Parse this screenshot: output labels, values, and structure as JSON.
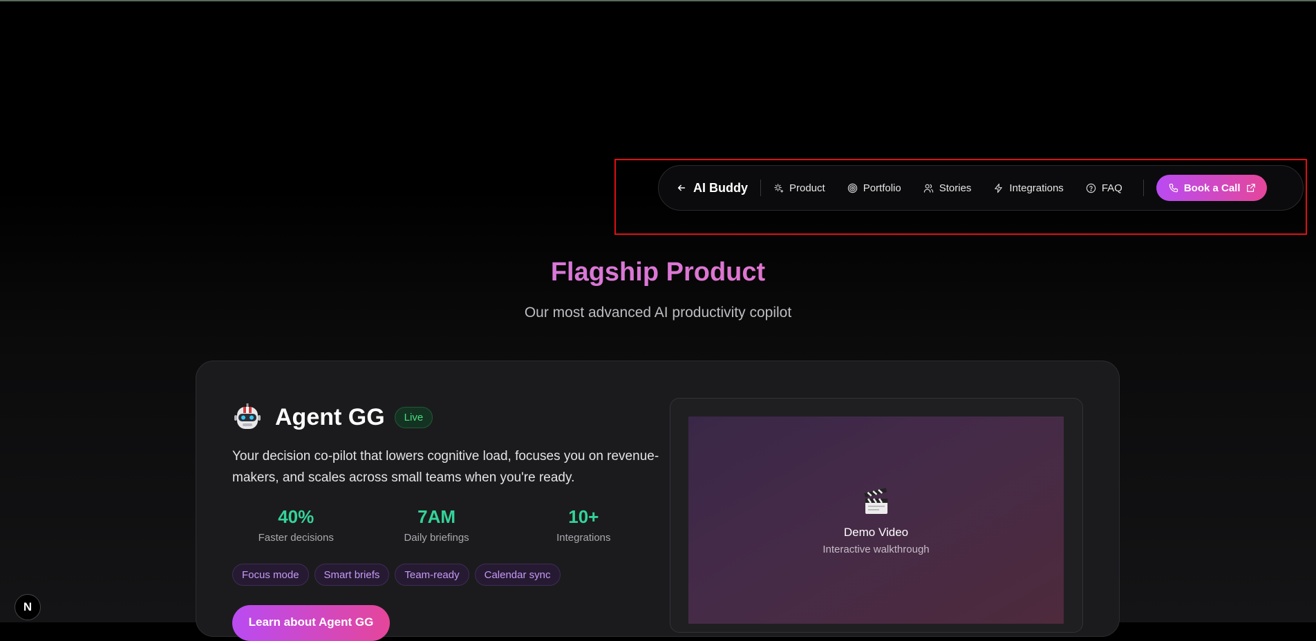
{
  "nav": {
    "brand": "AI Buddy",
    "items": [
      {
        "label": "Product",
        "icon": "sparkles-icon"
      },
      {
        "label": "Portfolio",
        "icon": "target-icon"
      },
      {
        "label": "Stories",
        "icon": "users-icon"
      },
      {
        "label": "Integrations",
        "icon": "zap-icon"
      },
      {
        "label": "FAQ",
        "icon": "help-circle-icon"
      }
    ],
    "cta": "Book a Call"
  },
  "hero": {
    "title": "Flagship Product",
    "subtitle": "Our most advanced AI productivity copilot"
  },
  "product": {
    "name": "Agent GG",
    "status": "Live",
    "description": "Your decision co-pilot that lowers cognitive load, focuses you on revenue-makers, and scales across small teams when you're ready.",
    "stats": [
      {
        "value": "40%",
        "label": "Faster decisions"
      },
      {
        "value": "7AM",
        "label": "Daily briefings"
      },
      {
        "value": "10+",
        "label": "Integrations"
      }
    ],
    "tags": [
      "Focus mode",
      "Smart briefs",
      "Team-ready",
      "Calendar sync"
    ],
    "cta": "Learn about Agent GG"
  },
  "video": {
    "title": "Demo Video",
    "subtitle": "Interactive walkthrough"
  },
  "badge": "N",
  "colors": {
    "accent_start": "#b94bf2",
    "accent_end": "#e5469a",
    "stat_green": "#34d399",
    "live_green": "#4ade80",
    "highlight_red": "#e01010"
  }
}
